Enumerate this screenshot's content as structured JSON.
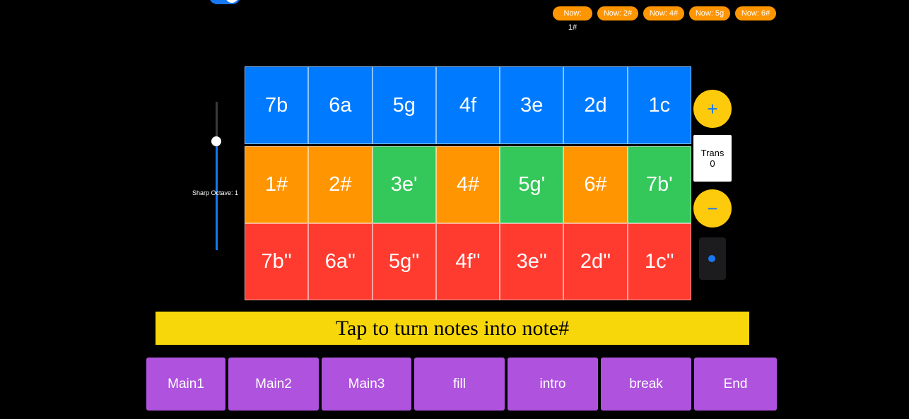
{
  "now_chips": [
    "Now: 1#",
    "Now: 2#",
    "Now: 4#",
    "Now: 5g",
    "Now: 6#"
  ],
  "slider": {
    "label": "Sharp Octave: 1",
    "value": 0.73
  },
  "grid": {
    "row1": [
      "7b",
      "6a",
      "5g",
      "4f",
      "3e",
      "2d",
      "1c"
    ],
    "row2": [
      "1#",
      "2#",
      "3e'",
      "4#",
      "5g'",
      "6#",
      "7b'"
    ],
    "row3": [
      "7b''",
      "6a''",
      "5g''",
      "4f''",
      "3e''",
      "2d''",
      "1c''"
    ]
  },
  "transpose": {
    "plus": "+",
    "minus": "−",
    "label": "Trans",
    "value": "0"
  },
  "banner": "Tap to turn notes into note#",
  "patterns": [
    "Main1",
    "Main2",
    "Main3",
    "fill",
    "intro",
    "break",
    "End"
  ],
  "colors": {
    "blue": "#007aff",
    "orange": "#ff9500",
    "green": "#34c759",
    "red": "#ff3b30",
    "yellow": "#fecb0c",
    "banner": "#f7d70a",
    "purple": "#af52de"
  }
}
